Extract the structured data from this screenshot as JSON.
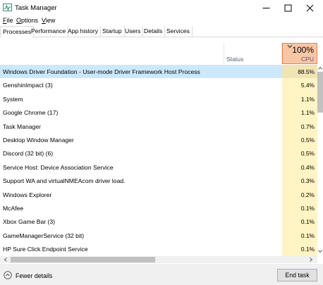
{
  "window": {
    "title": "Task Manager",
    "controls": {
      "minimize": "minimize-icon",
      "maximize": "maximize-icon",
      "close": "close-icon"
    }
  },
  "menu": {
    "file": "File",
    "options": "Options",
    "view": "View"
  },
  "tabs": [
    {
      "label": "Processes",
      "active": true
    },
    {
      "label": "Performance"
    },
    {
      "label": "App history"
    },
    {
      "label": "Startup"
    },
    {
      "label": "Users"
    },
    {
      "label": "Details"
    },
    {
      "label": "Services"
    }
  ],
  "columns": {
    "status": "Status",
    "cpu_total": "100%",
    "cpu": "CPU"
  },
  "processes": [
    {
      "name": "Windows Driver Foundation - User-mode Driver Framework Host Process",
      "cpu": "88.5%",
      "selected": true
    },
    {
      "name": "GenshinImpact (3)",
      "cpu": "5.4%"
    },
    {
      "name": "System",
      "cpu": "1.1%"
    },
    {
      "name": "Google Chrome (17)",
      "cpu": "1.1%"
    },
    {
      "name": "Task Manager",
      "cpu": "0.7%"
    },
    {
      "name": "Desktop Window Manager",
      "cpu": "0.5%"
    },
    {
      "name": "Discord (32 bit) (6)",
      "cpu": "0.5%"
    },
    {
      "name": "Service Host: Device Association Service",
      "cpu": "0.4%"
    },
    {
      "name": "Support WA and virtualNMEAcom driver load.",
      "cpu": "0.3%"
    },
    {
      "name": "Windows Explorer",
      "cpu": "0.2%"
    },
    {
      "name": "McAfee",
      "cpu": "0.1%"
    },
    {
      "name": "Xbox Game Bar (3)",
      "cpu": "0.1%"
    },
    {
      "name": "GameManagerService (32 bit)",
      "cpu": "0.1%"
    },
    {
      "name": "HP Sure Click Endpoint Service",
      "cpu": "0.1%"
    }
  ],
  "footer": {
    "fewer_details": "Fewer details",
    "end_task": "End task"
  },
  "colors": {
    "cpu_header": "#f9c6a5",
    "cpu_cell": "#fff4c4",
    "selection": "#cce8ff"
  }
}
